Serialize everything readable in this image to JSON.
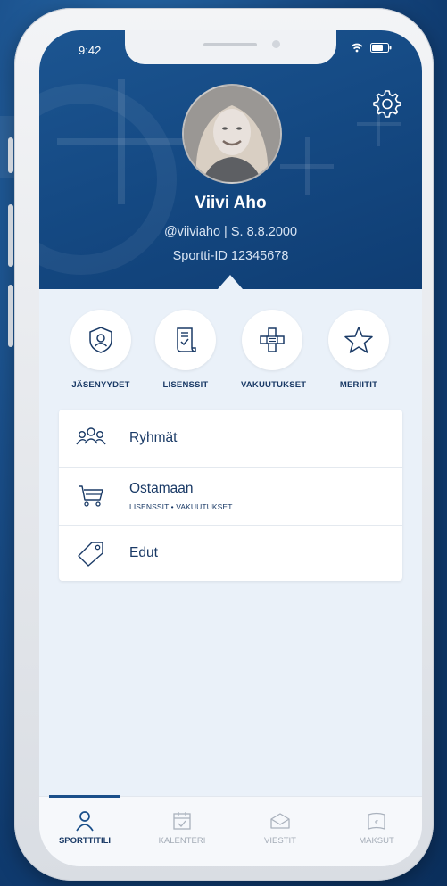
{
  "status_bar": {
    "time": "9:42"
  },
  "profile": {
    "name": "Viivi Aho",
    "handle_line": "@viiviaho  |  S. 8.8.2000",
    "sportti_id": "Sportti-ID 12345678"
  },
  "quick_actions": [
    {
      "label": "JÄSENYYDET",
      "icon": "shield-user-icon"
    },
    {
      "label": "LISENSSIT",
      "icon": "license-document-icon"
    },
    {
      "label": "VAKUUTUKSET",
      "icon": "insurance-cross-icon"
    },
    {
      "label": "MERIITIT",
      "icon": "star-icon"
    }
  ],
  "menu": [
    {
      "title": "Ryhmät",
      "icon": "group-icon"
    },
    {
      "title": "Ostamaan",
      "subtitle": "LISENSSIT • VAKUUTUKSET",
      "icon": "cart-icon"
    },
    {
      "title": "Edut",
      "icon": "tag-icon"
    }
  ],
  "tabs": [
    {
      "label": "SPORTTITILI",
      "icon": "person-icon",
      "active": true
    },
    {
      "label": "KALENTERI",
      "icon": "calendar-icon",
      "active": false
    },
    {
      "label": "VIESTIT",
      "icon": "envelope-icon",
      "active": false
    },
    {
      "label": "MAKSUT",
      "icon": "wallet-icon",
      "active": false
    }
  ],
  "colors": {
    "primary": "#1a4f8a",
    "accent_dark": "#1a3a66",
    "surface": "#eaf1f9"
  }
}
